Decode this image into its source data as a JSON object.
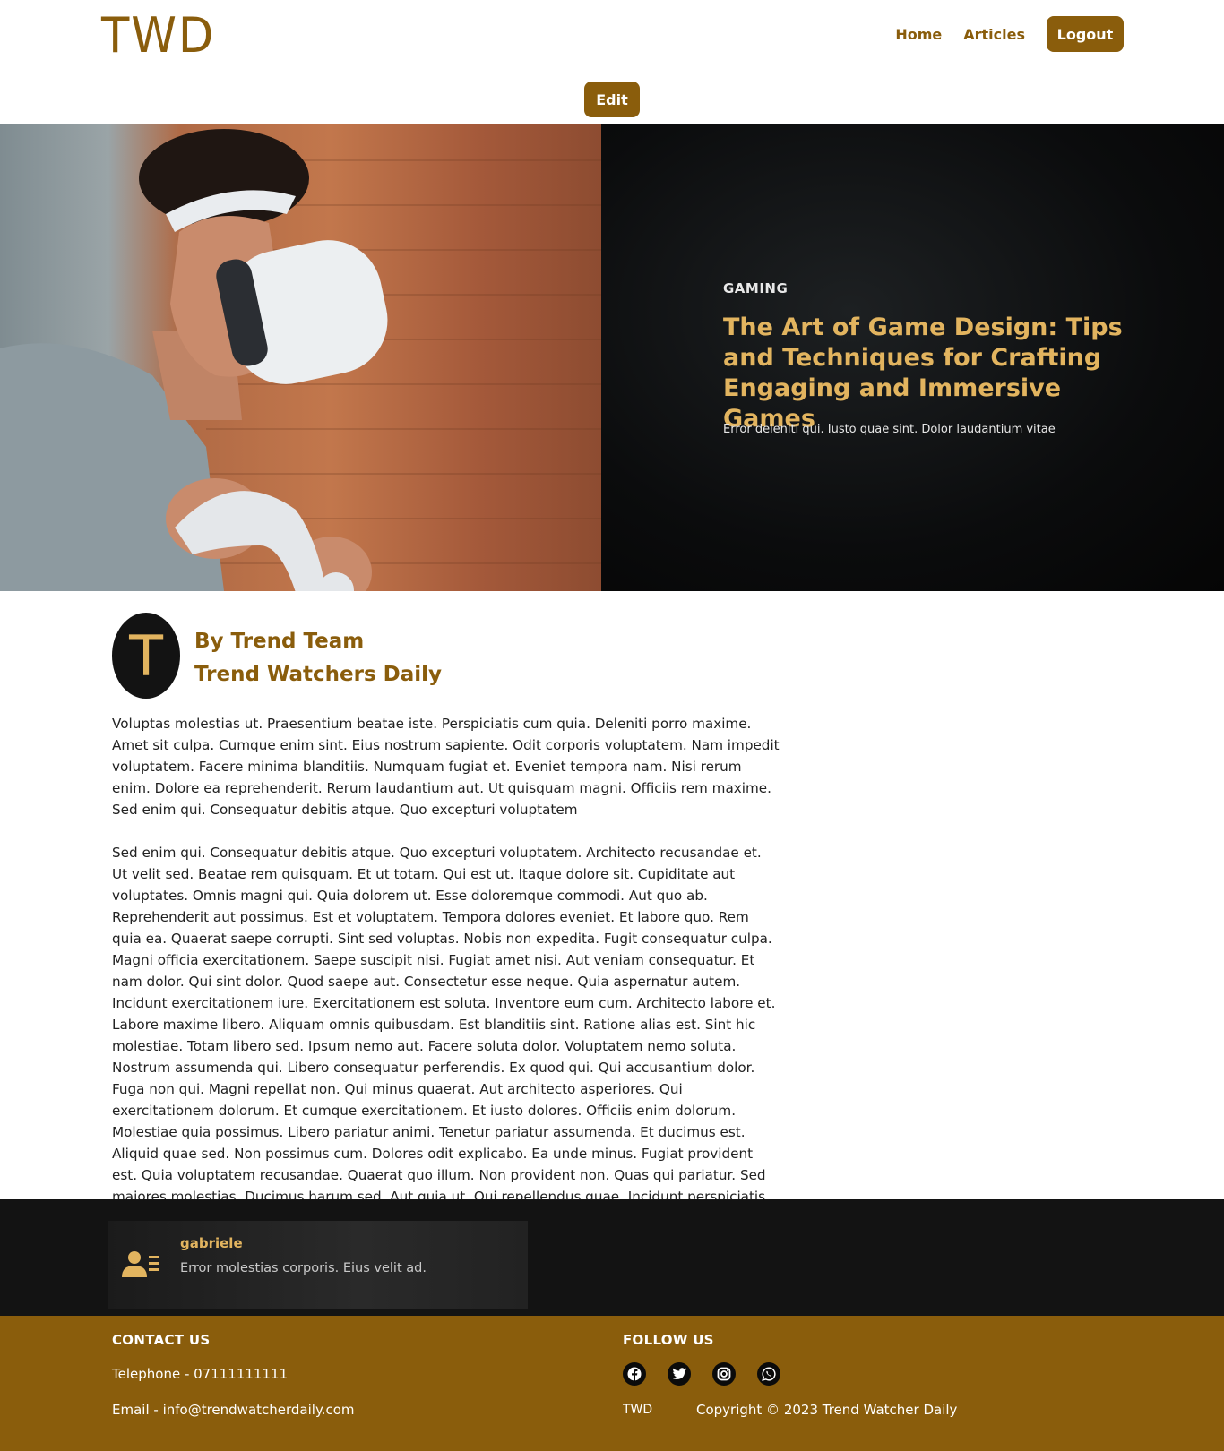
{
  "header": {
    "logo": "TWD",
    "nav": [
      "Home",
      "Articles"
    ],
    "logout_label": "Logout",
    "edit_label": "Edit"
  },
  "hero": {
    "image_alt": "person wearing VR headset",
    "category": "GAMING",
    "title": "The Art of Game Design: Tips and Techniques for Crafting Engaging and Immersive Games",
    "subtitle": "Error deleniti qui. Iusto quae sint. Dolor laudantium vitae"
  },
  "author": {
    "initial": "T",
    "by": "By Trend Team",
    "publication": "Trend Watchers Daily"
  },
  "article": {
    "paragraphs": [
      "Voluptas molestias ut. Praesentium beatae iste. Perspiciatis cum quia. Deleniti porro maxime. Amet sit culpa. Cumque enim sint. Eius nostrum sapiente. Odit corporis voluptatem. Nam impedit voluptatem. Facere minima blanditiis. Numquam fugiat et. Eveniet tempora nam. Nisi rerum enim. Dolore ea reprehenderit. Rerum laudantium aut. Ut quisquam magni. Officiis rem maxime. Sed enim qui. Consequatur debitis atque. Quo excepturi voluptatem",
      "Sed enim qui. Consequatur debitis atque. Quo excepturi voluptatem. Architecto recusandae et. Ut velit sed. Beatae rem quisquam. Et ut totam. Qui est ut. Itaque dolore sit. Cupiditate aut voluptates. Omnis magni qui. Quia dolorem ut. Esse doloremque commodi. Aut quo ab. Reprehenderit aut possimus. Est et voluptatem. Tempora dolores eveniet. Et labore quo. Rem quia ea. Quaerat saepe corrupti. Sint sed voluptas. Nobis non expedita. Fugit consequatur culpa. Magni officia exercitationem. Saepe suscipit nisi. Fugiat amet nisi. Aut veniam consequatur. Et nam dolor. Qui sint dolor. Quod saepe aut. Consectetur esse neque. Quia aspernatur autem. Incidunt exercitationem iure. Exercitationem est soluta. Inventore eum cum. Architecto labore et. Labore maxime libero. Aliquam omnis quibusdam. Est blanditiis sint. Ratione alias est. Sint hic molestiae. Totam libero sed. Ipsum nemo aut. Facere soluta dolor. Voluptatem nemo soluta. Nostrum assumenda qui. Libero consequatur perferendis. Ex quod qui. Qui accusantium dolor. Fuga non qui. Magni repellat non. Qui minus quaerat. Aut architecto asperiores. Qui exercitationem dolorum. Et cumque exercitationem. Et iusto dolores. Officiis enim dolorum. Molestiae quia possimus. Libero pariatur animi. Tenetur pariatur assumenda. Et ducimus est. Aliquid quae sed. Non possimus cum. Dolores odit explicabo. Ea unde minus. Fugiat provident est. Quia voluptatem recusandae. Quaerat quo illum. Non provident non. Quas qui pariatur. Sed maiores molestias. Ducimus harum sed. Aut quia ut. Qui repellendus quae. Incidunt perspiciatis ."
    ]
  },
  "comment": {
    "icon": "contact-card-icon",
    "name": "gabriele",
    "text": "Error molestias corporis. Eius velit ad."
  },
  "footer": {
    "contact_title": "CONTACT US",
    "telephone": "Telephone - 07111111111",
    "email": "Email - info@trendwatcherdaily.com",
    "follow_title": "FOLLOW US",
    "socials": [
      "facebook-icon",
      "twitter-icon",
      "instagram-icon",
      "whatsapp-icon"
    ],
    "logo": "TWD",
    "copyright": "Copyright © 2023 Trend Watcher Daily"
  },
  "colors": {
    "brand": "#8a5d0c",
    "accent": "#e2b45f",
    "dark": "#131313"
  }
}
